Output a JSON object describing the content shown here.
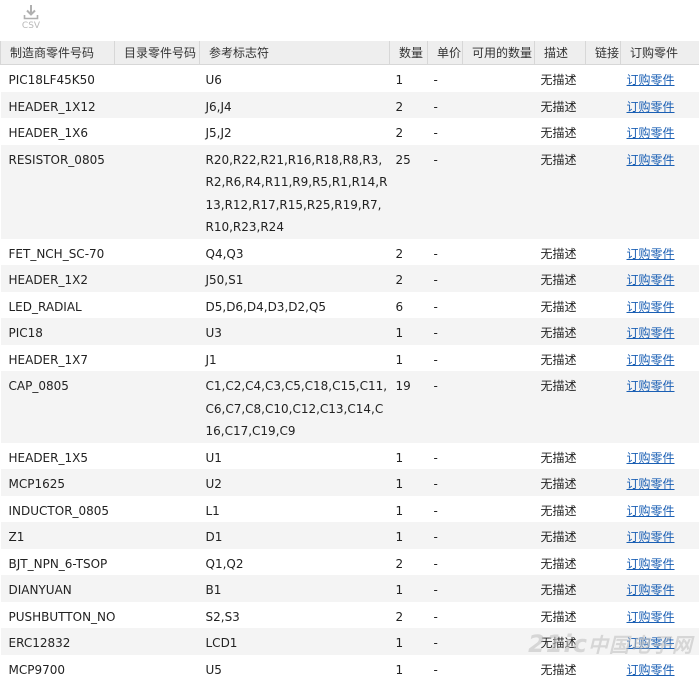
{
  "toolbar": {
    "csv_label": "CSV"
  },
  "table": {
    "columns": [
      "制造商零件号码",
      "目录零件号码",
      "参考标志符",
      "数量",
      "单价",
      "可用的数量",
      "描述",
      "链接",
      "订购零件"
    ],
    "rows": [
      {
        "mfr_part": "PIC18LF45K50",
        "catalog_part": "",
        "refs": "U6",
        "qty": "1",
        "price": "-",
        "available": "",
        "desc": "无描述",
        "link": "",
        "order": "订购零件"
      },
      {
        "mfr_part": "HEADER_1X12",
        "catalog_part": "",
        "refs": "J6,J4",
        "qty": "2",
        "price": "-",
        "available": "",
        "desc": "无描述",
        "link": "",
        "order": "订购零件"
      },
      {
        "mfr_part": "HEADER_1X6",
        "catalog_part": "",
        "refs": "J5,J2",
        "qty": "2",
        "price": "-",
        "available": "",
        "desc": "无描述",
        "link": "",
        "order": "订购零件"
      },
      {
        "mfr_part": "RESISTOR_0805",
        "catalog_part": "",
        "refs": "R20,R22,R21,R16,R18,R8,R3,R2,R6,R4,R11,R9,R5,R1,R14,R13,R12,R17,R15,R25,R19,R7,R10,R23,R24",
        "qty": "25",
        "price": "-",
        "available": "",
        "desc": "无描述",
        "link": "",
        "order": "订购零件"
      },
      {
        "mfr_part": "FET_NCH_SC-70",
        "catalog_part": "",
        "refs": "Q4,Q3",
        "qty": "2",
        "price": "-",
        "available": "",
        "desc": "无描述",
        "link": "",
        "order": "订购零件"
      },
      {
        "mfr_part": "HEADER_1X2",
        "catalog_part": "",
        "refs": "J50,S1",
        "qty": "2",
        "price": "-",
        "available": "",
        "desc": "无描述",
        "link": "",
        "order": "订购零件"
      },
      {
        "mfr_part": "LED_RADIAL",
        "catalog_part": "",
        "refs": "D5,D6,D4,D3,D2,Q5",
        "qty": "6",
        "price": "-",
        "available": "",
        "desc": "无描述",
        "link": "",
        "order": "订购零件"
      },
      {
        "mfr_part": "PIC18",
        "catalog_part": "",
        "refs": "U3",
        "qty": "1",
        "price": "-",
        "available": "",
        "desc": "无描述",
        "link": "",
        "order": "订购零件"
      },
      {
        "mfr_part": "HEADER_1X7",
        "catalog_part": "",
        "refs": "J1",
        "qty": "1",
        "price": "-",
        "available": "",
        "desc": "无描述",
        "link": "",
        "order": "订购零件"
      },
      {
        "mfr_part": "CAP_0805",
        "catalog_part": "",
        "refs": "C1,C2,C4,C3,C5,C18,C15,C11,C6,C7,C8,C10,C12,C13,C14,C16,C17,C19,C9",
        "qty": "19",
        "price": "-",
        "available": "",
        "desc": "无描述",
        "link": "",
        "order": "订购零件"
      },
      {
        "mfr_part": "HEADER_1X5",
        "catalog_part": "",
        "refs": "U1",
        "qty": "1",
        "price": "-",
        "available": "",
        "desc": "无描述",
        "link": "",
        "order": "订购零件"
      },
      {
        "mfr_part": "MCP1625",
        "catalog_part": "",
        "refs": "U2",
        "qty": "1",
        "price": "-",
        "available": "",
        "desc": "无描述",
        "link": "",
        "order": "订购零件"
      },
      {
        "mfr_part": "INDUCTOR_0805",
        "catalog_part": "",
        "refs": "L1",
        "qty": "1",
        "price": "-",
        "available": "",
        "desc": "无描述",
        "link": "",
        "order": "订购零件"
      },
      {
        "mfr_part": "Z1",
        "catalog_part": "",
        "refs": "D1",
        "qty": "1",
        "price": "-",
        "available": "",
        "desc": "无描述",
        "link": "",
        "order": "订购零件"
      },
      {
        "mfr_part": "BJT_NPN_6-TSOP",
        "catalog_part": "",
        "refs": "Q1,Q2",
        "qty": "2",
        "price": "-",
        "available": "",
        "desc": "无描述",
        "link": "",
        "order": "订购零件"
      },
      {
        "mfr_part": "DIANYUAN",
        "catalog_part": "",
        "refs": "B1",
        "qty": "1",
        "price": "-",
        "available": "",
        "desc": "无描述",
        "link": "",
        "order": "订购零件"
      },
      {
        "mfr_part": "PUSHBUTTON_NO",
        "catalog_part": "",
        "refs": "S2,S3",
        "qty": "2",
        "price": "-",
        "available": "",
        "desc": "无描述",
        "link": "",
        "order": "订购零件"
      },
      {
        "mfr_part": "ERC12832",
        "catalog_part": "",
        "refs": "LCD1",
        "qty": "1",
        "price": "-",
        "available": "",
        "desc": "无描述",
        "link": "",
        "order": "订购零件"
      },
      {
        "mfr_part": "MCP9700",
        "catalog_part": "",
        "refs": "U5",
        "qty": "1",
        "price": "-",
        "available": "",
        "desc": "无描述",
        "link": "",
        "order": "订购零件"
      }
    ]
  },
  "watermark": {
    "latin": "21ic",
    "cn": "中国电子网"
  }
}
